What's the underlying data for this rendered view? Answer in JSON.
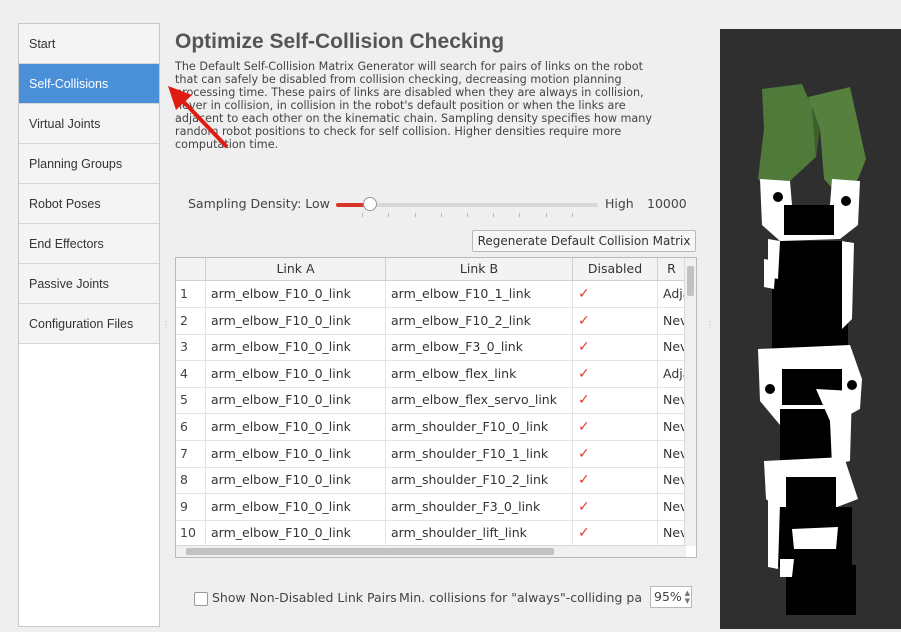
{
  "sidebar": {
    "items": [
      {
        "label": "Start",
        "active": false
      },
      {
        "label": "Self-Collisions",
        "active": true
      },
      {
        "label": "Virtual Joints",
        "active": false
      },
      {
        "label": "Planning Groups",
        "active": false
      },
      {
        "label": "Robot Poses",
        "active": false
      },
      {
        "label": "End Effectors",
        "active": false
      },
      {
        "label": "Passive Joints",
        "active": false
      },
      {
        "label": "Configuration Files",
        "active": false
      }
    ]
  },
  "main": {
    "title": "Optimize Self-Collision Checking",
    "description_lines": [
      "The Default Self-Collision Matrix Generator will search for pairs of links on the robot",
      "that can safely be disabled from collision checking, decreasing motion planning",
      "processing time. These pairs of links are disabled when they are always in collision,",
      "never in collision, in collision in the robot's default position or when the links are",
      "adjacent to each other on the kinematic chain. Sampling density specifies how many",
      "random robot positions to check for self collision. Higher densities require more",
      "computation time."
    ],
    "sampling": {
      "label": "Sampling Density: Low",
      "high_label": "High",
      "value": "10000",
      "slider_fraction": 0.13
    },
    "regenerate_button": "Regenerate Default Collision Matrix",
    "table": {
      "columns": [
        "",
        "Link A",
        "Link B",
        "Disabled",
        "R"
      ],
      "rows": [
        {
          "num": "1",
          "a": "arm_elbow_F10_0_link",
          "b": "arm_elbow_F10_1_link",
          "disabled": true,
          "reason": "Adja"
        },
        {
          "num": "2",
          "a": "arm_elbow_F10_0_link",
          "b": "arm_elbow_F10_2_link",
          "disabled": true,
          "reason": "Nev"
        },
        {
          "num": "3",
          "a": "arm_elbow_F10_0_link",
          "b": "arm_elbow_F3_0_link",
          "disabled": true,
          "reason": "Nev"
        },
        {
          "num": "4",
          "a": "arm_elbow_F10_0_link",
          "b": "arm_elbow_flex_link",
          "disabled": true,
          "reason": "Adja"
        },
        {
          "num": "5",
          "a": "arm_elbow_F10_0_link",
          "b": "arm_elbow_flex_servo_link",
          "disabled": true,
          "reason": "Nev"
        },
        {
          "num": "6",
          "a": "arm_elbow_F10_0_link",
          "b": "arm_shoulder_F10_0_link",
          "disabled": true,
          "reason": "Nev"
        },
        {
          "num": "7",
          "a": "arm_elbow_F10_0_link",
          "b": "arm_shoulder_F10_1_link",
          "disabled": true,
          "reason": "Nev"
        },
        {
          "num": "8",
          "a": "arm_elbow_F10_0_link",
          "b": "arm_shoulder_F10_2_link",
          "disabled": true,
          "reason": "Nev"
        },
        {
          "num": "9",
          "a": "arm_elbow_F10_0_link",
          "b": "arm_shoulder_F3_0_link",
          "disabled": true,
          "reason": "Nev"
        },
        {
          "num": "10",
          "a": "arm_elbow_F10_0_link",
          "b": "arm_shoulder_lift_link",
          "disabled": true,
          "reason": "Nev"
        }
      ]
    },
    "show_non_disabled_label": "Show Non-Disabled Link Pairs",
    "min_collisions_label": "Min. collisions for \"always\"-colliding pa",
    "min_collisions_value": "95%"
  },
  "icons": {
    "check": "✓",
    "spin_up": "▲",
    "spin_down": "▼",
    "splitter": "⋮"
  },
  "colors": {
    "accent": "#4a90d9",
    "slider_fill": "#d9362a",
    "check": "#e23b2e",
    "gripper": "#4f7a3a",
    "viewport_bg": "#2f2f2f",
    "annotation_arrow": "#e01b12"
  }
}
